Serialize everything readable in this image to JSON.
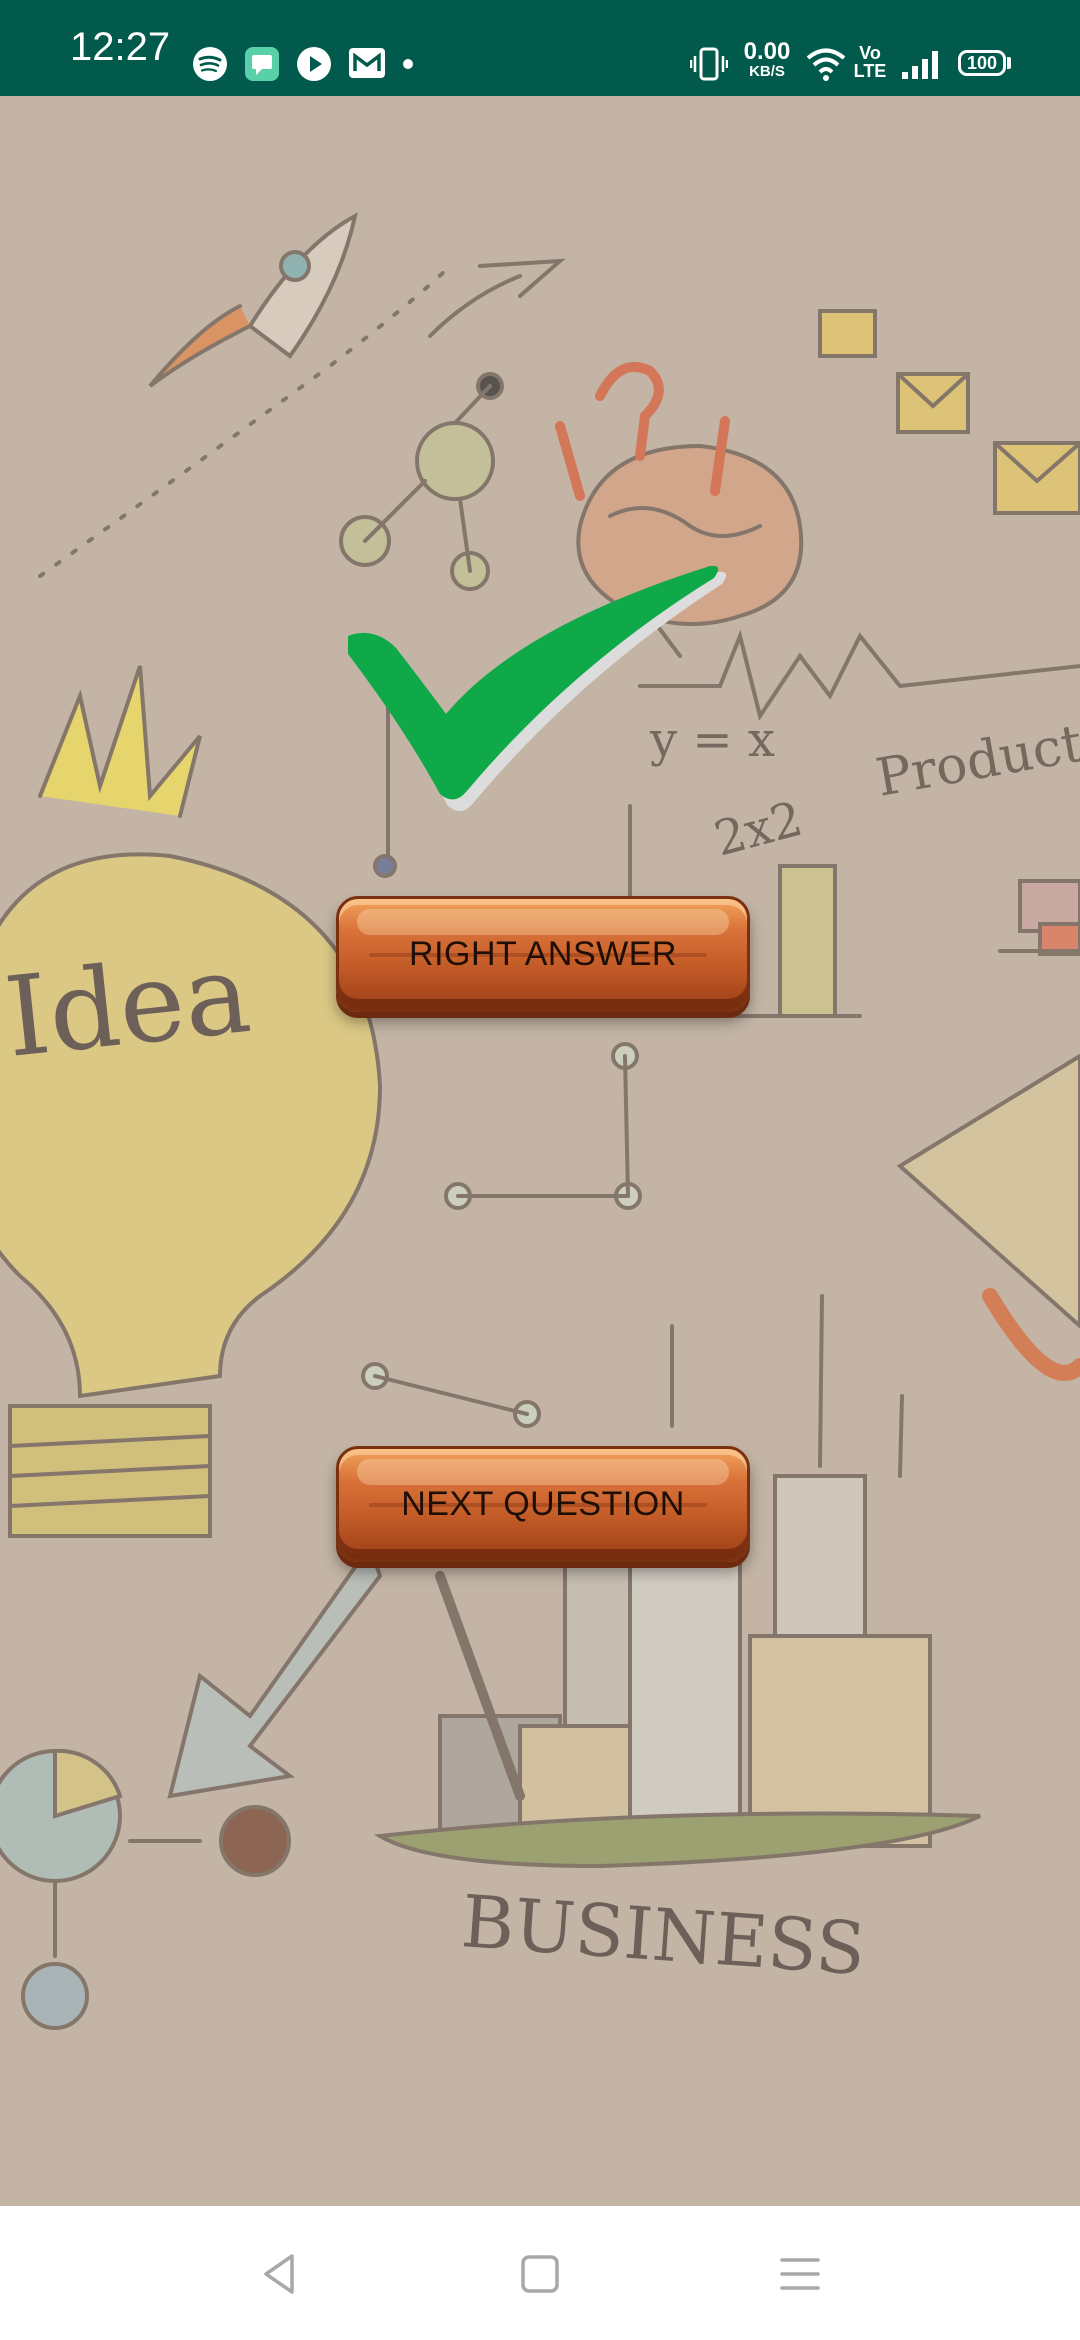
{
  "status_bar": {
    "time": "12:27",
    "net_speed_value": "0.00",
    "net_speed_unit": "KB/S",
    "network_label_top": "Vo",
    "network_label_bottom": "LTE",
    "battery": "100",
    "background_color": "#015a4b",
    "left_icons": [
      "spotify-icon",
      "messages-icon",
      "play-icon",
      "mail-icon",
      "dot-icon"
    ],
    "right_icons": [
      "vibrate-icon",
      "wifi-icon",
      "signal-icon",
      "battery-icon"
    ]
  },
  "quiz": {
    "result_icon": "checkmark-icon",
    "result_color": "#10a94a",
    "right_answer_label": "RIGHT ANSWER",
    "next_question_label": "NEXT QUESTION"
  },
  "background": {
    "doodle_idea_text": "Idea",
    "doodle_product_text": "Product",
    "doodle_business_text": "BUSINESS",
    "doodle_formula_1": "y = x",
    "doodle_formula_2": "2x2"
  },
  "nav_bar": {
    "icons": [
      "back-icon",
      "home-icon",
      "menu-icon"
    ]
  }
}
